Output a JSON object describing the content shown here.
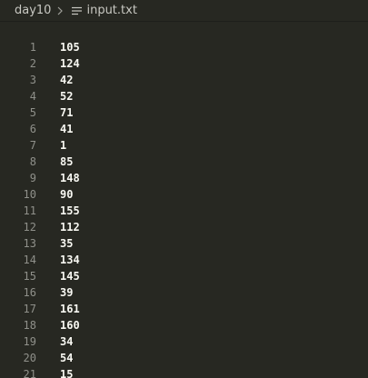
{
  "breadcrumb": {
    "folder": "day10",
    "file": "input.txt",
    "separator_icon": "chevron-right-icon",
    "file_icon": "text-file-icon"
  },
  "colors": {
    "background": "#272822",
    "line_number": "#8f908a",
    "text": "#f8f8f2",
    "breadcrumb_text": "#c8c8c2"
  },
  "editor": {
    "lines": [
      {
        "number": "1",
        "text": "105"
      },
      {
        "number": "2",
        "text": "124"
      },
      {
        "number": "3",
        "text": "42"
      },
      {
        "number": "4",
        "text": "52"
      },
      {
        "number": "5",
        "text": "71"
      },
      {
        "number": "6",
        "text": "41"
      },
      {
        "number": "7",
        "text": "1"
      },
      {
        "number": "8",
        "text": "85"
      },
      {
        "number": "9",
        "text": "148"
      },
      {
        "number": "10",
        "text": "90"
      },
      {
        "number": "11",
        "text": "155"
      },
      {
        "number": "12",
        "text": "112"
      },
      {
        "number": "13",
        "text": "35"
      },
      {
        "number": "14",
        "text": "134"
      },
      {
        "number": "15",
        "text": "145"
      },
      {
        "number": "16",
        "text": "39"
      },
      {
        "number": "17",
        "text": "161"
      },
      {
        "number": "18",
        "text": "160"
      },
      {
        "number": "19",
        "text": "34"
      },
      {
        "number": "20",
        "text": "54"
      },
      {
        "number": "21",
        "text": "15"
      }
    ]
  }
}
